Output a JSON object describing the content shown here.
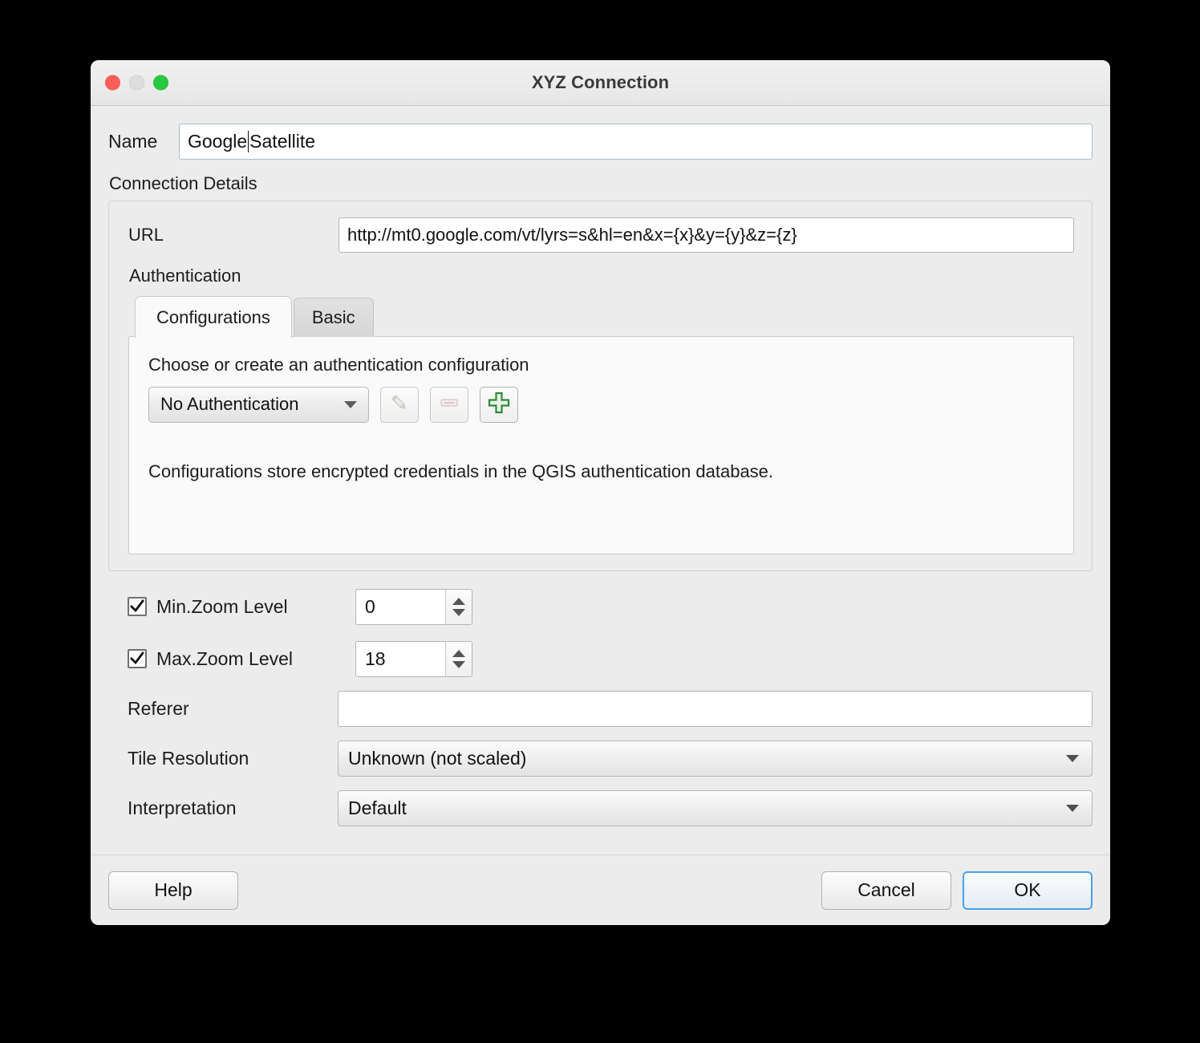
{
  "window": {
    "title": "XYZ Connection",
    "traffic_lights": {
      "close": "close-button",
      "minimize": "minimize-button",
      "maximize": "maximize-button"
    },
    "colors": {
      "close": "#ff5f57",
      "minimize": "#dddddd",
      "maximize": "#28c840",
      "focus_border": "#a8bdd2",
      "default_button_border": "#4a9fe8",
      "add_icon_green": "#2f8a38",
      "page_background": "#000000",
      "dialog_background": "#ececec"
    }
  },
  "name_field": {
    "label": "Name",
    "value_before_caret": "Google ",
    "value_after_caret": "Satellite",
    "full_value": "Google Satellite",
    "placeholder": ""
  },
  "connection_details": {
    "section_label": "Connection Details",
    "url": {
      "label": "URL",
      "value": "http://mt0.google.com/vt/lyrs=s&hl=en&x={x}&y={y}&z={z}",
      "placeholder": ""
    },
    "authentication": {
      "label": "Authentication",
      "tabs": [
        {
          "label": "Configurations",
          "active": true
        },
        {
          "label": "Basic",
          "active": false
        }
      ],
      "hint": "Choose or create an authentication configuration",
      "config_select": {
        "value": "No Authentication",
        "options": [
          "No Authentication"
        ]
      },
      "buttons": [
        {
          "name": "edit-config-button",
          "icon": "pencil-icon",
          "enabled": false
        },
        {
          "name": "remove-config-button",
          "icon": "minus-icon",
          "enabled": false
        },
        {
          "name": "add-config-button",
          "icon": "plus-icon",
          "enabled": true
        }
      ],
      "note": "Configurations store encrypted credentials in the QGIS authentication database."
    }
  },
  "options": {
    "min_zoom": {
      "label": "Min.Zoom Level",
      "checked": true,
      "value": "0"
    },
    "max_zoom": {
      "label": "Max.Zoom Level",
      "checked": true,
      "value": "18"
    },
    "referer": {
      "label": "Referer",
      "value": "",
      "placeholder": ""
    },
    "tile_resolution": {
      "label": "Tile Resolution",
      "value": "Unknown (not scaled)",
      "options": [
        "Unknown (not scaled)"
      ]
    },
    "interpretation": {
      "label": "Interpretation",
      "value": "Default",
      "options": [
        "Default"
      ]
    }
  },
  "footer": {
    "help_label": "Help",
    "cancel_label": "Cancel",
    "ok_label": "OK"
  }
}
